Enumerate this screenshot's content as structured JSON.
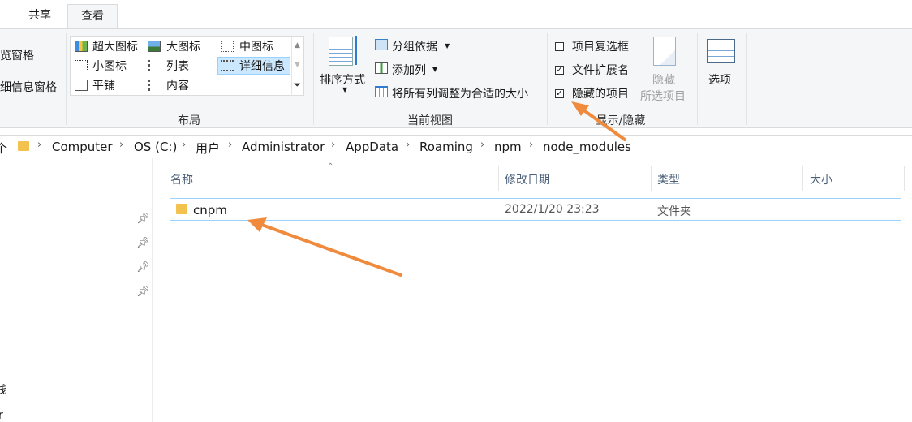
{
  "tabs": {
    "share": "共享",
    "view": "查看"
  },
  "ribbon": {
    "pane": {
      "preview_label": "览窗格",
      "details_label": "细信息窗格"
    },
    "layout": {
      "items": {
        "extra_large": "超大图标",
        "large": "大图标",
        "medium": "中图标",
        "small": "小图标",
        "list": "列表",
        "details": "详细信息",
        "tiles": "平铺",
        "content": "内容"
      },
      "group_label": "布局"
    },
    "current_view": {
      "sort_label": "排序方式",
      "group_by": "分组依据",
      "add_columns": "添加列",
      "size_all_columns": "将所有列调整为合适的大小",
      "group_label": "当前视图"
    },
    "show_hide": {
      "item_checkboxes": {
        "label": "项目复选框",
        "checked": false
      },
      "file_extensions": {
        "label": "文件扩展名",
        "checked": true
      },
      "hidden_items": {
        "label": "隐藏的项目",
        "checked": true
      },
      "hide_selected_line1": "隐藏",
      "hide_selected_line2": "所选项目",
      "group_label": "显示/隐藏"
    },
    "options_label": "选项"
  },
  "address": {
    "nav_arrow": "个",
    "crumbs": [
      "Computer",
      "OS (C:)",
      "用户",
      "Administrator",
      "AppData",
      "Roaming",
      "npm",
      "node_modules"
    ]
  },
  "nav_pane": {
    "partial_item_1": "线",
    "partial_item_2": "r"
  },
  "file_list": {
    "columns": {
      "name": "名称",
      "date": "修改日期",
      "type": "类型",
      "size": "大小"
    },
    "rows": [
      {
        "name": "cnpm",
        "date": "2022/1/20 23:23",
        "type": "文件夹",
        "size": ""
      }
    ]
  },
  "colors": {
    "selection_bg": "#cce8ff",
    "selection_border": "#99d1ff",
    "annotation_arrow": "#f08a3c",
    "folder": "#f2c14e"
  }
}
